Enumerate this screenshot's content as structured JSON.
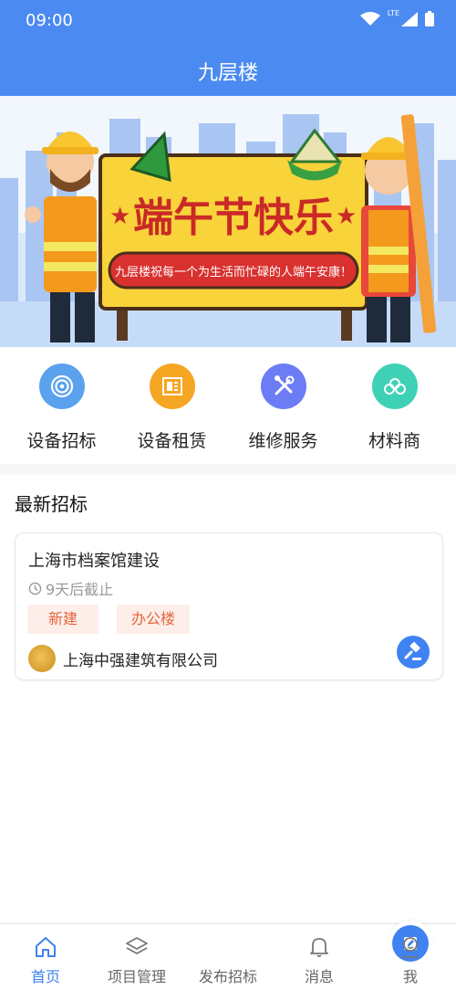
{
  "status": {
    "time": "09:00",
    "network": "LTE"
  },
  "header": {
    "title": "九层楼"
  },
  "banner": {
    "headline": "端午节快乐",
    "subline": "九层楼祝每一个为生活而忙碌的人端午安康！"
  },
  "categories": [
    {
      "label": "设备招标",
      "icon": "target-icon",
      "color": "#5aa1ee"
    },
    {
      "label": "设备租赁",
      "icon": "document-icon",
      "color": "#f5a623"
    },
    {
      "label": "维修服务",
      "icon": "tools-icon",
      "color": "#6c7cf5"
    },
    {
      "label": "材料商",
      "icon": "pipes-icon",
      "color": "#3fd1b5"
    }
  ],
  "latest": {
    "title": "最新招标",
    "items": [
      {
        "title": "上海市档案馆建设",
        "deadline": "9天后截止",
        "tags": [
          "新建",
          "办公楼"
        ],
        "company": "上海中强建筑有限公司"
      }
    ]
  },
  "tabbar": {
    "items": [
      {
        "label": "首页",
        "icon": "home-icon",
        "active": true
      },
      {
        "label": "项目管理",
        "icon": "layers-icon",
        "active": false
      },
      {
        "label": "发布招标",
        "icon": "edit-icon",
        "active": false
      },
      {
        "label": "消息",
        "icon": "bell-icon",
        "active": false
      },
      {
        "label": "我",
        "icon": "user-icon",
        "active": false
      }
    ]
  },
  "colors": {
    "primary": "#4b8af0",
    "tag_text": "#e5653c",
    "tag_bg": "#fdeee9"
  }
}
